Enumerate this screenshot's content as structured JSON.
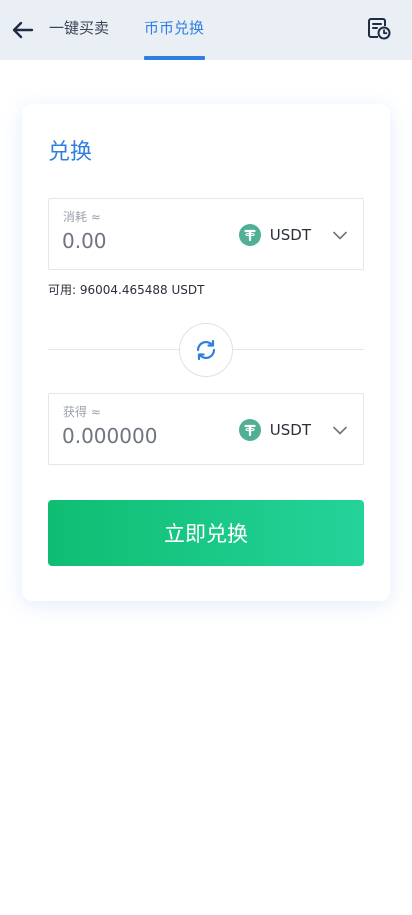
{
  "header": {
    "back_icon": "arrow-left-icon",
    "tabs": [
      {
        "label": "一键买卖",
        "active": false
      },
      {
        "label": "币币兑换",
        "active": true
      }
    ],
    "records_icon": "order-history-icon"
  },
  "card": {
    "title": "兑换",
    "pay": {
      "label": "消耗 ≈",
      "placeholder": "0.00",
      "coin": "USDT",
      "coin_icon": "tether-icon"
    },
    "available": "可用: 96004.465488 USDT",
    "swap_icon": "refresh-icon",
    "receive": {
      "label": "获得 ≈",
      "placeholder": "0.000000",
      "coin": "USDT",
      "coin_icon": "tether-icon"
    },
    "submit_label": "立即兑换"
  },
  "colors": {
    "accent": "#2f7ee0",
    "header_bg": "#eaeff6",
    "button_gradient_start": "#0fbd72",
    "button_gradient_end": "#24d39a",
    "tether": "#50af95"
  }
}
